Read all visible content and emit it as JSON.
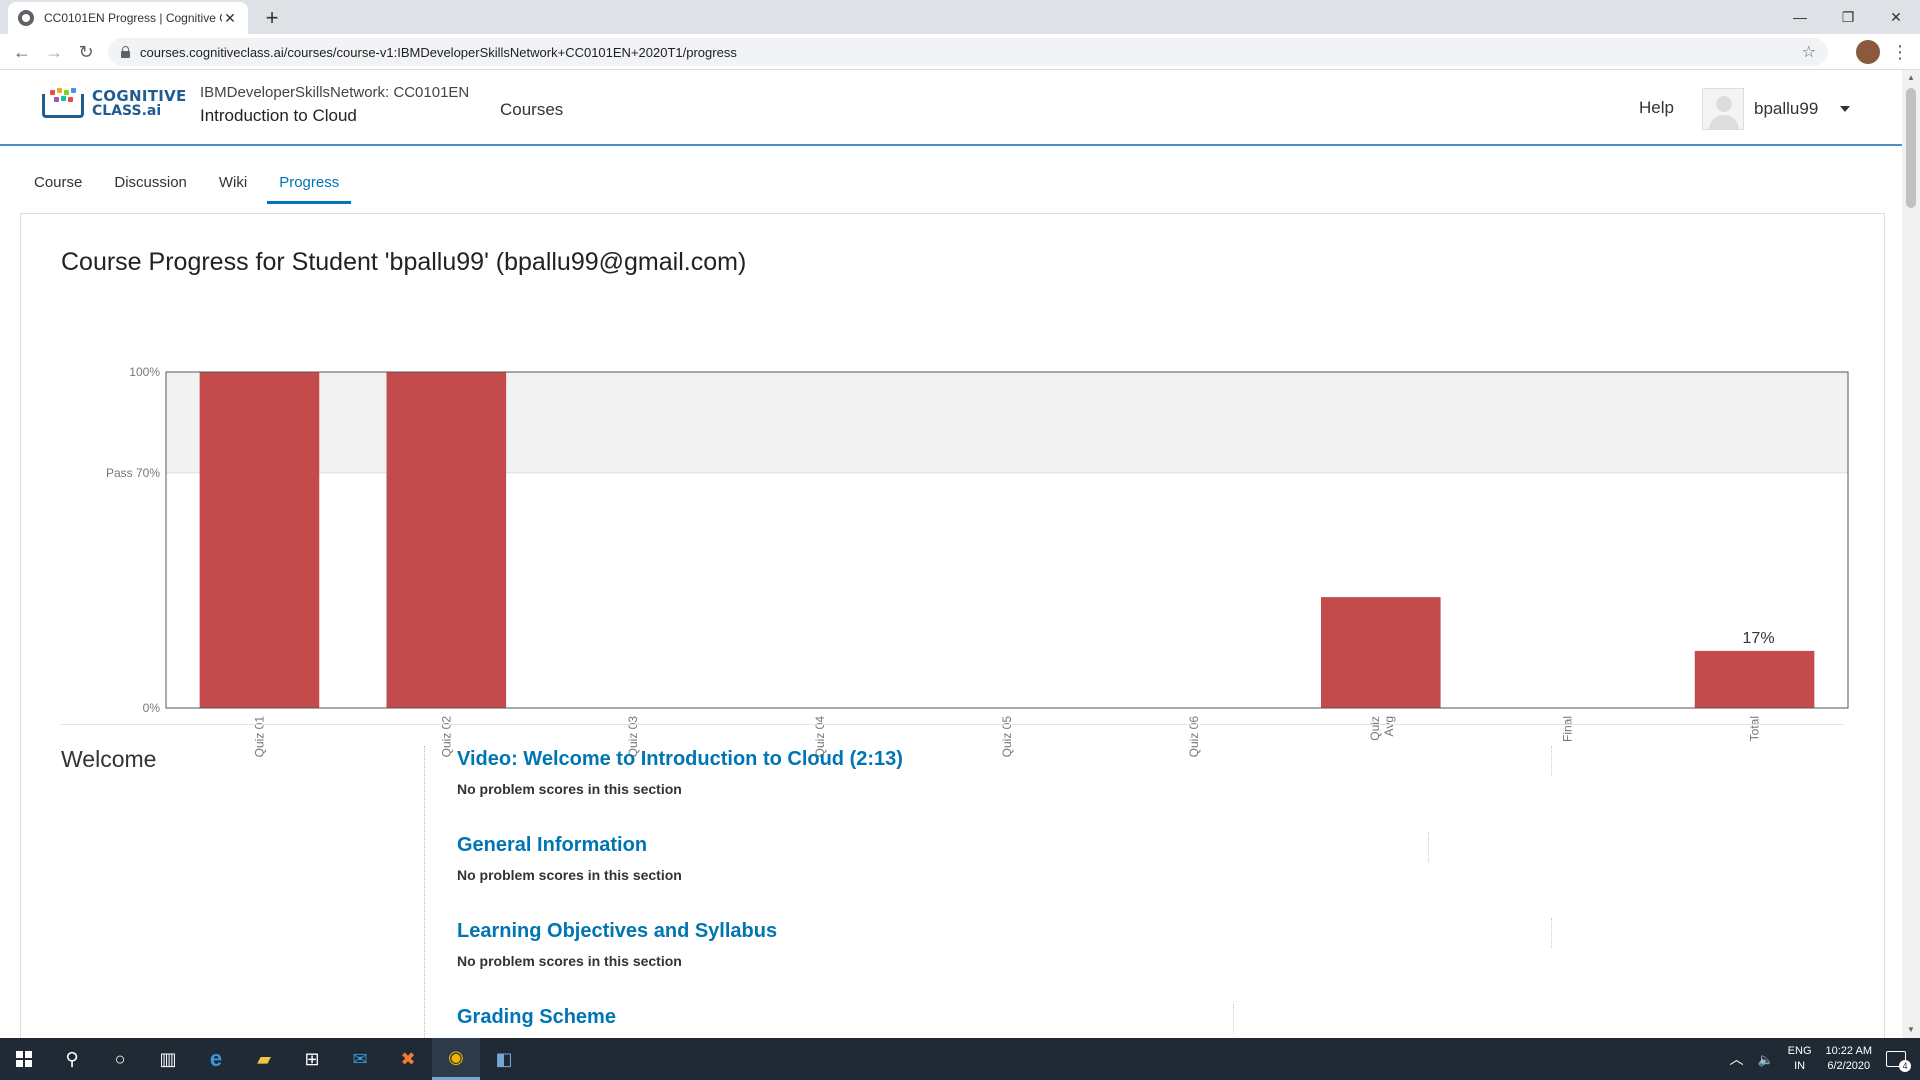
{
  "browser": {
    "tab_title": "CC0101EN Progress | Cognitive C",
    "url": "courses.cognitiveclass.ai/courses/course-v1:IBMDeveloperSkillsNetwork+CC0101EN+2020T1/progress"
  },
  "header": {
    "logo_line1": "COGNITIVE",
    "logo_line2": "CLASS.ai",
    "course_org": "IBMDeveloperSkillsNetwork: CC0101EN",
    "course_name": "Introduction to Cloud",
    "nav_courses": "Courses",
    "help": "Help",
    "username": "bpallu99"
  },
  "course_tabs": [
    {
      "label": "Course"
    },
    {
      "label": "Discussion"
    },
    {
      "label": "Wiki"
    },
    {
      "label": "Progress"
    }
  ],
  "progress_title": "Course Progress for Student 'bpallu99' (bpallu99@gmail.com)",
  "chart_data": {
    "type": "bar",
    "categories": [
      "Quiz 01",
      "Quiz 02",
      "Quiz 03",
      "Quiz 04",
      "Quiz 05",
      "Quiz 06",
      "Quiz Avg",
      "Final",
      "Total"
    ],
    "values": [
      100,
      100,
      0,
      0,
      0,
      0,
      33,
      0,
      17
    ],
    "y_ticks": [
      {
        "value": 0,
        "label": "0%"
      },
      {
        "value": 70,
        "label": "Pass 70%"
      },
      {
        "value": 100,
        "label": "100%"
      }
    ],
    "ylim": [
      0,
      100
    ],
    "pass_threshold": 70,
    "data_labels": [
      {
        "category": "Total",
        "text": "17%"
      }
    ],
    "bar_color": "#c44b4b",
    "pass_band_color": "#f2f2f2"
  },
  "chapter": {
    "title": "Welcome",
    "sections": [
      {
        "title": "Video: Welcome to Introduction to Cloud (2:13)",
        "sub": "No problem scores in this section"
      },
      {
        "title": "General Information",
        "sub": "No problem scores in this section"
      },
      {
        "title": "Learning Objectives and Syllabus",
        "sub": "No problem scores in this section"
      },
      {
        "title": "Grading Scheme",
        "sub": ""
      }
    ]
  },
  "taskbar": {
    "lang_line1": "ENG",
    "lang_line2": "IN",
    "time": "10:22 AM",
    "date": "6/2/2020",
    "notifications": "4"
  }
}
